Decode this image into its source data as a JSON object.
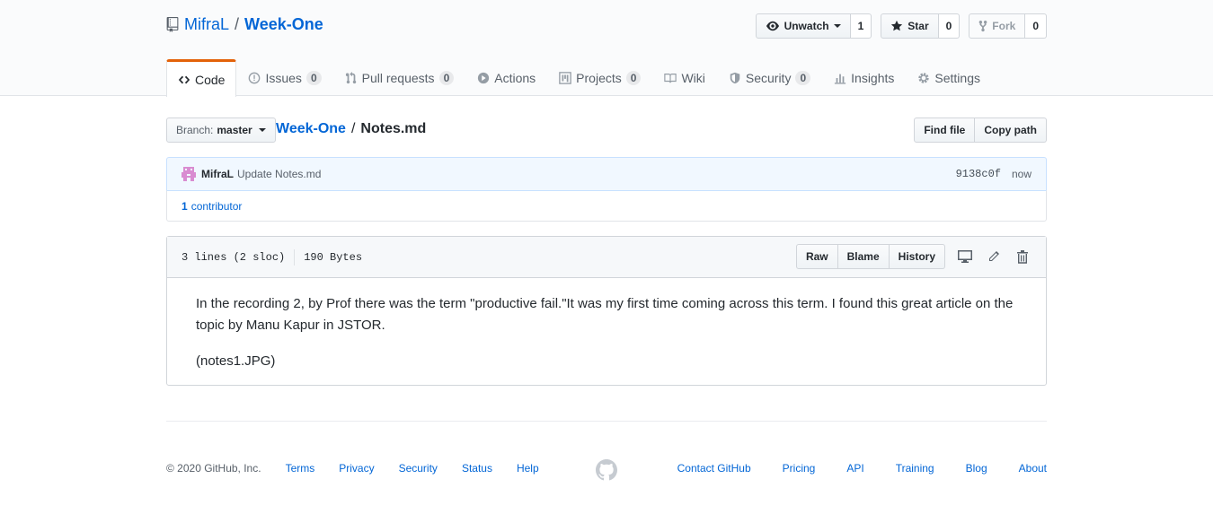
{
  "repo": {
    "owner": "MifraL",
    "separator": "/",
    "name": "Week-One"
  },
  "actions": {
    "watch_label": "Unwatch",
    "watch_count": "1",
    "star_label": "Star",
    "star_count": "0",
    "fork_label": "Fork",
    "fork_count": "0"
  },
  "nav": {
    "items": [
      {
        "label": "Code",
        "count": null
      },
      {
        "label": "Issues",
        "count": "0"
      },
      {
        "label": "Pull requests",
        "count": "0"
      },
      {
        "label": "Actions",
        "count": null
      },
      {
        "label": "Projects",
        "count": "0"
      },
      {
        "label": "Wiki",
        "count": null
      },
      {
        "label": "Security",
        "count": "0"
      },
      {
        "label": "Insights",
        "count": null
      },
      {
        "label": "Settings",
        "count": null
      }
    ]
  },
  "file_nav": {
    "branch_prefix": "Branch:",
    "branch_name": "master",
    "crumb_repo": "Week-One",
    "crumb_sep": "/",
    "crumb_file": "Notes.md",
    "find_file": "Find file",
    "copy_path": "Copy path"
  },
  "commit": {
    "author": "MifraL",
    "message": "Update Notes.md",
    "sha": "9138c0f",
    "time": "now",
    "contributor_count": "1",
    "contributor_label": "contributor"
  },
  "file": {
    "lines": "3 lines (2 sloc)",
    "size": "190 Bytes",
    "raw": "Raw",
    "blame": "Blame",
    "history": "History",
    "paragraphs": [
      "In the recording 2, by Prof there was the term \"productive fail.\"It was my first time coming across this term. I found this great article on the topic by Manu Kapur in JSTOR.",
      "(notes1.JPG)"
    ]
  },
  "footer": {
    "copyright": "© 2020 GitHub, Inc.",
    "left_links": [
      "Terms",
      "Privacy",
      "Security",
      "Status",
      "Help"
    ],
    "right_links": [
      "Contact GitHub",
      "Pricing",
      "API",
      "Training",
      "Blog",
      "About"
    ]
  },
  "colors": {
    "link": "#0366d6",
    "tab_accent": "#e36209",
    "commit_bg": "#f1f8ff"
  }
}
